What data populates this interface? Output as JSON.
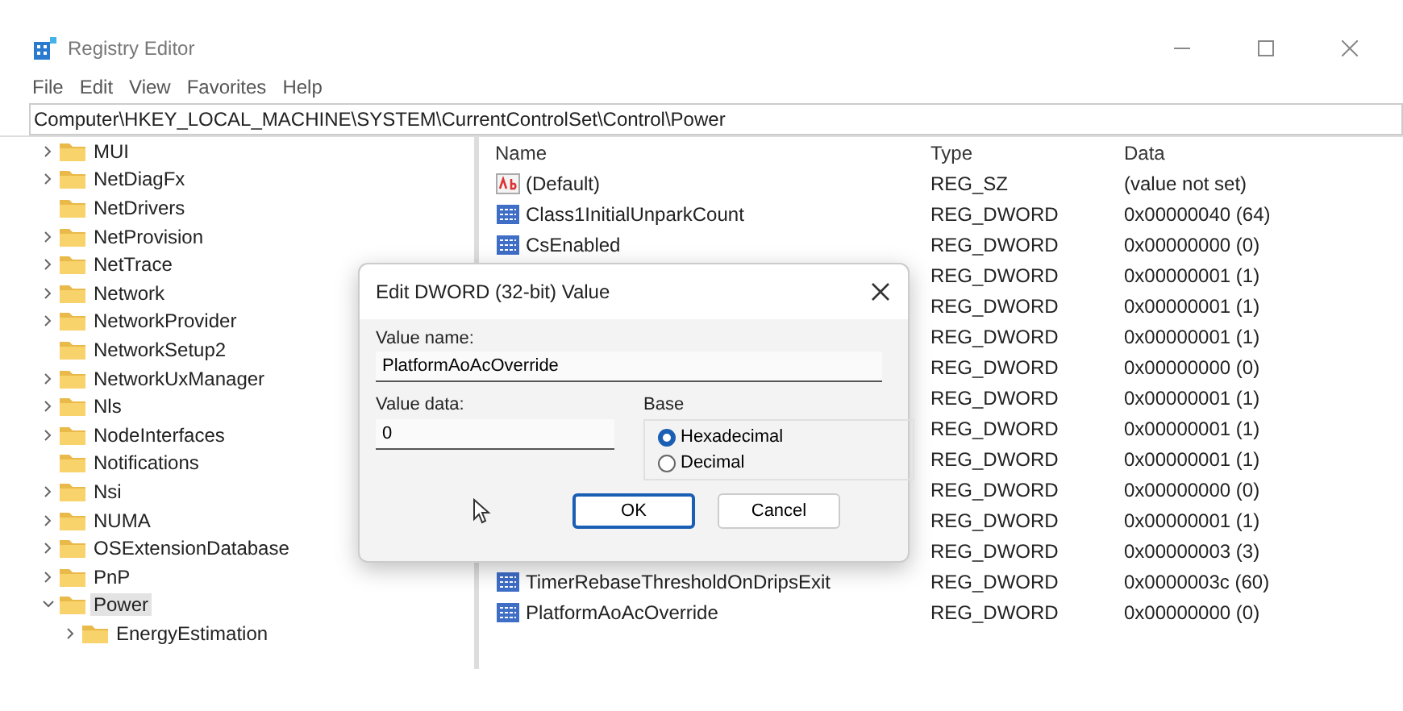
{
  "window": {
    "title": "Registry Editor"
  },
  "menu": [
    "File",
    "Edit",
    "View",
    "Favorites",
    "Help"
  ],
  "address": "Computer\\HKEY_LOCAL_MACHINE\\SYSTEM\\CurrentControlSet\\Control\\Power",
  "tree": [
    {
      "label": "MUI",
      "expanded": false,
      "selected": false
    },
    {
      "label": "NetDiagFx",
      "expanded": false,
      "selected": false
    },
    {
      "label": "NetDrivers",
      "selected": false
    },
    {
      "label": "NetProvision",
      "expanded": false,
      "selected": false
    },
    {
      "label": "NetTrace",
      "expanded": false,
      "selected": false
    },
    {
      "label": "Network",
      "expanded": false,
      "selected": false
    },
    {
      "label": "NetworkProvider",
      "expanded": false,
      "selected": false
    },
    {
      "label": "NetworkSetup2",
      "selected": false
    },
    {
      "label": "NetworkUxManager",
      "expanded": false,
      "selected": false
    },
    {
      "label": "Nls",
      "expanded": false,
      "selected": false
    },
    {
      "label": "NodeInterfaces",
      "expanded": false,
      "selected": false
    },
    {
      "label": "Notifications",
      "selected": false
    },
    {
      "label": "Nsi",
      "expanded": false,
      "selected": false
    },
    {
      "label": "NUMA",
      "expanded": false,
      "selected": false
    },
    {
      "label": "OSExtensionDatabase",
      "expanded": false,
      "selected": false
    },
    {
      "label": "PnP",
      "expanded": false,
      "selected": false
    },
    {
      "label": "Power",
      "expanded": true,
      "selected": true,
      "children": [
        {
          "label": "EnergyEstimation",
          "expanded": false,
          "selected": false
        }
      ]
    }
  ],
  "table": {
    "columns": [
      "Name",
      "Type",
      "Data"
    ],
    "rows": [
      {
        "kind": "string",
        "name": "(Default)",
        "type": "REG_SZ",
        "data": "(value not set)"
      },
      {
        "kind": "dword",
        "name": "Class1InitialUnparkCount",
        "type": "REG_DWORD",
        "data": "0x00000040 (64)"
      },
      {
        "kind": "dword",
        "name": "CsEnabled",
        "type": "REG_DWORD",
        "data": "0x00000000 (0)"
      },
      {
        "type": "REG_DWORD",
        "data": "0x00000001 (1)"
      },
      {
        "type": "REG_DWORD",
        "data": "0x00000001 (1)"
      },
      {
        "type": "REG_DWORD",
        "data": "0x00000001 (1)"
      },
      {
        "type": "REG_DWORD",
        "data": "0x00000000 (0)"
      },
      {
        "type": "REG_DWORD",
        "data": "0x00000001 (1)"
      },
      {
        "type": "REG_DWORD",
        "data": "0x00000001 (1)"
      },
      {
        "type": "REG_DWORD",
        "data": "0x00000001 (1)"
      },
      {
        "type": "REG_DWORD",
        "data": "0x00000000 (0)"
      },
      {
        "type": "REG_DWORD",
        "data": "0x00000001 (1)"
      },
      {
        "type": "REG_DWORD",
        "data": "0x00000003 (3)"
      },
      {
        "kind": "dword",
        "name": "TimerRebaseThresholdOnDripsExit",
        "type": "REG_DWORD",
        "data": "0x0000003c (60)"
      },
      {
        "kind": "dword",
        "name": "PlatformAoAcOverride",
        "type": "REG_DWORD",
        "data": "0x00000000 (0)"
      }
    ]
  },
  "dialog": {
    "title": "Edit DWORD (32-bit) Value",
    "value_name_label": "Value name:",
    "value_name": "PlatformAoAcOverride",
    "value_data_label": "Value data:",
    "value_data": "0",
    "base_label": "Base",
    "bases": [
      {
        "label": "Hexadecimal",
        "selected": true
      },
      {
        "label": "Decimal",
        "selected": false
      }
    ],
    "buttons": [
      "OK",
      "Cancel"
    ]
  }
}
